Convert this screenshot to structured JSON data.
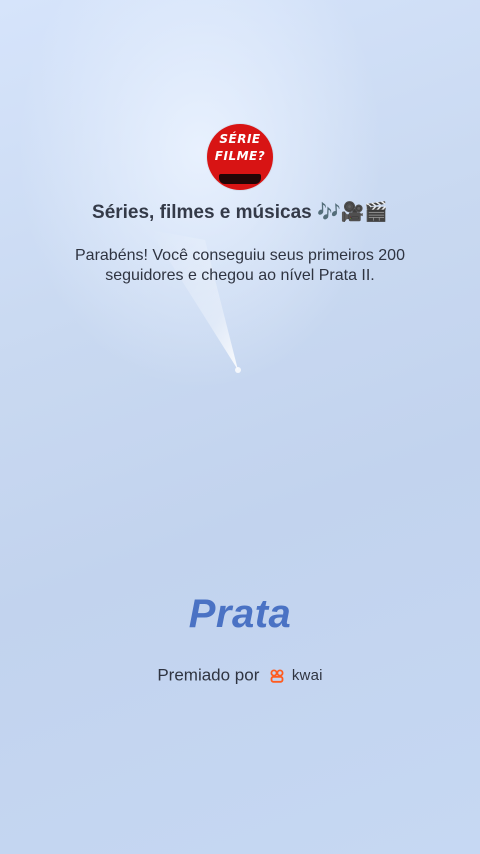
{
  "profile": {
    "avatar_line1": "SÉRIE",
    "avatar_line2": "FILME?",
    "channel_title": "Séries, filmes e músicas 🎶🎥🎬"
  },
  "message": "Parabéns! Você conseguiu seus primeiros 200 seguidores e chegou ao nível Prata II.",
  "level": {
    "name": "Prata"
  },
  "footer": {
    "awarded_by": "Premiado por",
    "brand": "kwai",
    "brand_icon": "kwai-logo-icon",
    "brand_color": "#ff5b1f"
  },
  "colors": {
    "level_text": "#4a72c4",
    "background": "#c6d8f3"
  }
}
